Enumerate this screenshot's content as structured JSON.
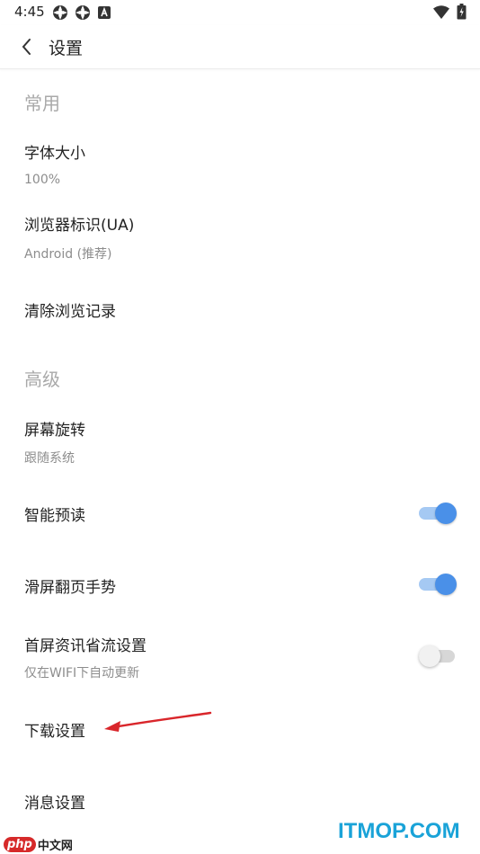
{
  "status_bar": {
    "time": "4:45",
    "icons": [
      "app-notification-icon",
      "app-notification-icon",
      "a-notification-icon",
      "wifi-icon",
      "battery-icon"
    ]
  },
  "appbar": {
    "back_icon": "chevron-left-icon",
    "title": "设置"
  },
  "sections": {
    "common": "常用",
    "advanced": "高级"
  },
  "rows": {
    "font_size": {
      "title": "字体大小",
      "value": "100%"
    },
    "user_agent": {
      "title": "浏览器标识(UA)",
      "value": "Android (推荐)"
    },
    "clear_history": {
      "title": "清除浏览记录"
    },
    "screen_rotation": {
      "title": "屏幕旋转",
      "value": "跟随系统"
    },
    "smart_preload": {
      "title": "智能预读",
      "enabled": true
    },
    "swipe_page_gesture": {
      "title": "滑屏翻页手势",
      "enabled": true
    },
    "homepage_data_saver": {
      "title": "首屏资讯省流设置",
      "subtitle": "仅在WIFI下自动更新",
      "enabled": false
    },
    "download_settings": {
      "title": "下载设置"
    },
    "message_settings": {
      "title": "消息设置"
    }
  },
  "colors": {
    "accent": "#4a90e8",
    "annotation_arrow": "#d9262b",
    "section_header": "#a9a9a9"
  },
  "watermarks": {
    "left_badge": "php",
    "left_text": "中文网",
    "right_text": "ITMOP.COM"
  }
}
